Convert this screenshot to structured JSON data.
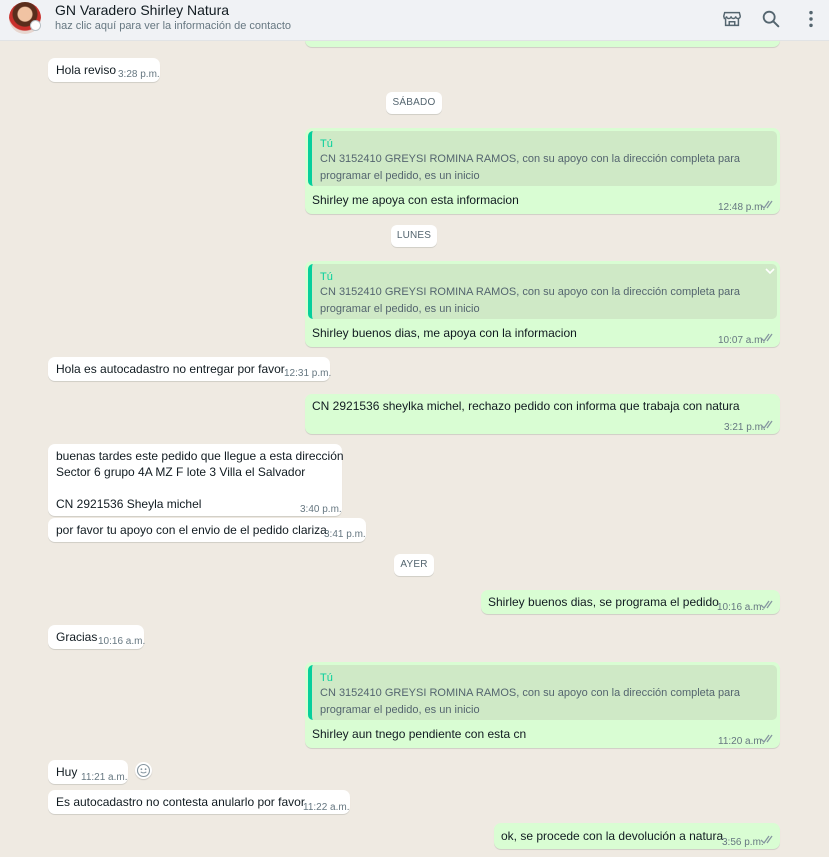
{
  "header": {
    "title": "GN Varadero Shirley Natura",
    "subtitle": "haz clic aquí para ver la información de contacto",
    "icons": [
      "shop-icon",
      "search-icon",
      "menu-icon"
    ]
  },
  "dates": {
    "sabado": "SÁBADO",
    "lunes": "LUNES",
    "ayer": "AYER"
  },
  "messages": [
    {
      "direction": "in",
      "text": "Hola reviso",
      "time": "3:28 p.m."
    },
    {
      "direction": "out",
      "quote_author": "Tú",
      "quote_text": "CN 3152410 GREYSI ROMINA RAMOS, con su apoyo con la dirección completa para\nprogramar el pedido, es un inicio",
      "text": "Shirley me apoya con esta informacion",
      "time": "12:48 p.m."
    },
    {
      "direction": "out",
      "quote_author": "Tú",
      "quote_text": "CN 3152410 GREYSI ROMINA RAMOS, con su apoyo con la dirección completa para\nprogramar el pedido, es un inicio",
      "text": "Shirley buenos dias, me apoya con la informacion",
      "time": "10:07 a.m."
    },
    {
      "direction": "in",
      "text": "Hola es autocadastro no entregar por favor",
      "time": "12:31 p.m."
    },
    {
      "direction": "out",
      "text": "CN 2921536 sheylka michel, rechazo pedido con informa que trabaja con natura",
      "time": "3:21 p.m."
    },
    {
      "direction": "in",
      "text": "buenas tardes este pedido que llegue a esta dirección\nSector 6 grupo 4A MZ F lote 3 Villa el Salvador\n\nCN 2921536 Sheyla michel",
      "time": "3:40 p.m."
    },
    {
      "direction": "in",
      "text": "por favor tu apoyo con el envio de el pedido clariza",
      "time": "3:41 p.m."
    },
    {
      "direction": "out",
      "text": "Shirley buenos dias, se programa el pedido",
      "time": "10:16 a.m."
    },
    {
      "direction": "in",
      "text": "Gracias",
      "time": "10:16 a.m."
    },
    {
      "direction": "out",
      "quote_author": "Tú",
      "quote_text": "CN 3152410 GREYSI ROMINA RAMOS, con su apoyo con la dirección completa para\nprogramar el pedido, es un inicio",
      "text": "Shirley aun tnego pendiente con esta cn",
      "time": "11:20 a.m."
    },
    {
      "direction": "in",
      "text": "Huy",
      "time": "11:21 a.m."
    },
    {
      "direction": "in",
      "text": "Es autocadastro no contesta anularlo por favor",
      "time": "11:22 a.m."
    },
    {
      "direction": "out",
      "text": "ok, se procede con la devolución a natura",
      "time": "3:56 p.m."
    }
  ]
}
